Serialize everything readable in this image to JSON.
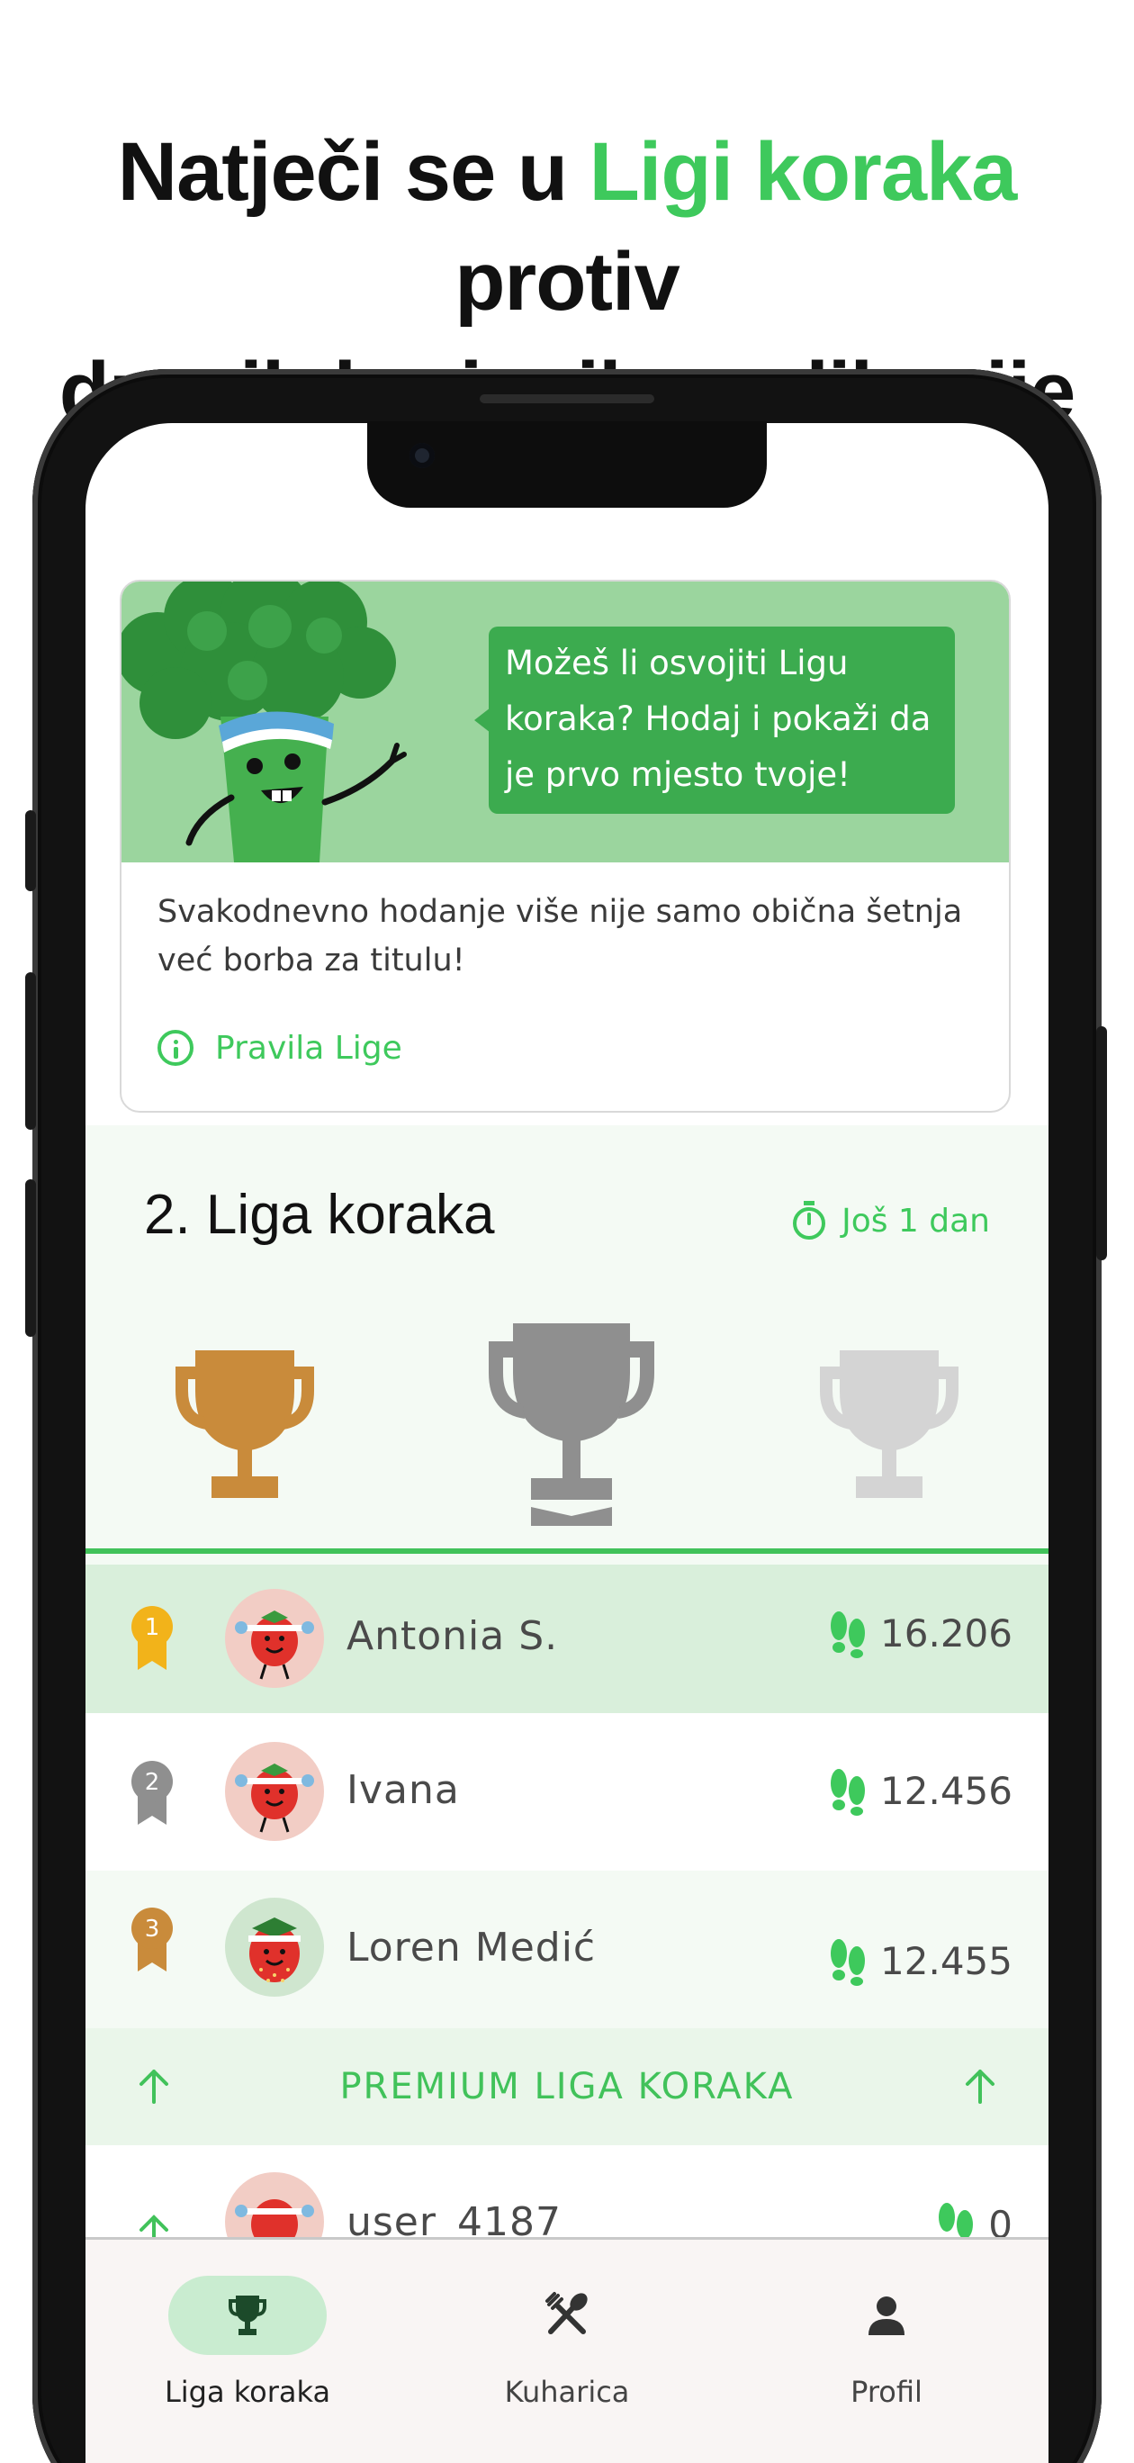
{
  "headline": {
    "line1_pre": "Natječi se u ",
    "line1_accent": "Ligi koraka",
    "line1_post": " protiv",
    "line2": "drugih korisnika aplikacije"
  },
  "promo": {
    "bubble_text": "Možeš li osvojiti Ligu koraka? Hodaj i pokaži da je prvo mjesto tvoje!",
    "body_text": "Svakodnevno hodanje više nije samo obična šetnja već borba za titulu!",
    "rules_link": "Pravila Lige"
  },
  "league": {
    "title": "2. Liga koraka",
    "time_left": "Još 1 dan",
    "trophies": [
      "bronze-trophy",
      "silver-trophy",
      "gold-trophy"
    ],
    "colors": {
      "bronze": "#c98b3b",
      "silver": "#8f8f8f",
      "gold_locked": "#d4d4d4"
    }
  },
  "leaderboard": [
    {
      "rank": "1",
      "name": "Antonia S.",
      "steps": "16.206",
      "highlight": true
    },
    {
      "rank": "2",
      "name": "Ivana",
      "steps": "12.456",
      "highlight": false
    },
    {
      "rank": "3",
      "name": "Loren Medić",
      "steps": "12.455",
      "highlight": false
    },
    {
      "rank": "",
      "name": "user_4187",
      "steps": "0",
      "highlight": false
    }
  ],
  "premium_banner": "PREMIUM LIGA KORAKA",
  "bottom_nav": [
    {
      "label": "Liga koraka",
      "icon": "trophy-icon",
      "active": true
    },
    {
      "label": "Kuharica",
      "icon": "utensils-icon",
      "active": false
    },
    {
      "label": "Profil",
      "icon": "person-icon",
      "active": false
    }
  ],
  "colors": {
    "accent": "#3ec95c",
    "highlight_row": "#d9efdb"
  }
}
